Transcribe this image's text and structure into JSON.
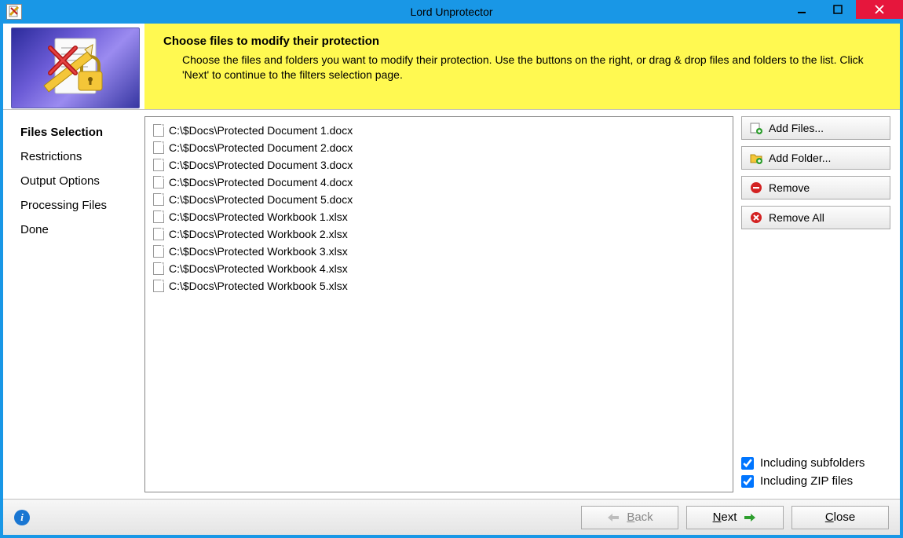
{
  "window": {
    "title": "Lord Unprotector"
  },
  "banner": {
    "heading": "Choose files to modify their protection",
    "description": "Choose the files and folders you want to modify their protection. Use the buttons on the right, or drag & drop files and folders to the list. Click 'Next' to continue to the filters selection page."
  },
  "sidebar": {
    "items": [
      {
        "label": "Files Selection",
        "current": true
      },
      {
        "label": "Restrictions",
        "current": false
      },
      {
        "label": "Output Options",
        "current": false
      },
      {
        "label": "Processing Files",
        "current": false
      },
      {
        "label": "Done",
        "current": false
      }
    ]
  },
  "files": [
    "C:\\$Docs\\Protected Document 1.docx",
    "C:\\$Docs\\Protected Document 2.docx",
    "C:\\$Docs\\Protected Document 3.docx",
    "C:\\$Docs\\Protected Document 4.docx",
    "C:\\$Docs\\Protected Document 5.docx",
    "C:\\$Docs\\Protected Workbook 1.xlsx",
    "C:\\$Docs\\Protected Workbook 2.xlsx",
    "C:\\$Docs\\Protected Workbook 3.xlsx",
    "C:\\$Docs\\Protected Workbook 4.xlsx",
    "C:\\$Docs\\Protected Workbook 5.xlsx"
  ],
  "actions": {
    "add_files": "Add Files...",
    "add_folder": "Add Folder...",
    "remove": "Remove",
    "remove_all": "Remove All"
  },
  "options": {
    "including_subfolders": {
      "label": "Including subfolders",
      "checked": true
    },
    "including_zip": {
      "label": "Including ZIP files",
      "checked": true
    }
  },
  "footer": {
    "back": "Back",
    "next": "Next",
    "close": "Close",
    "back_enabled": false
  }
}
